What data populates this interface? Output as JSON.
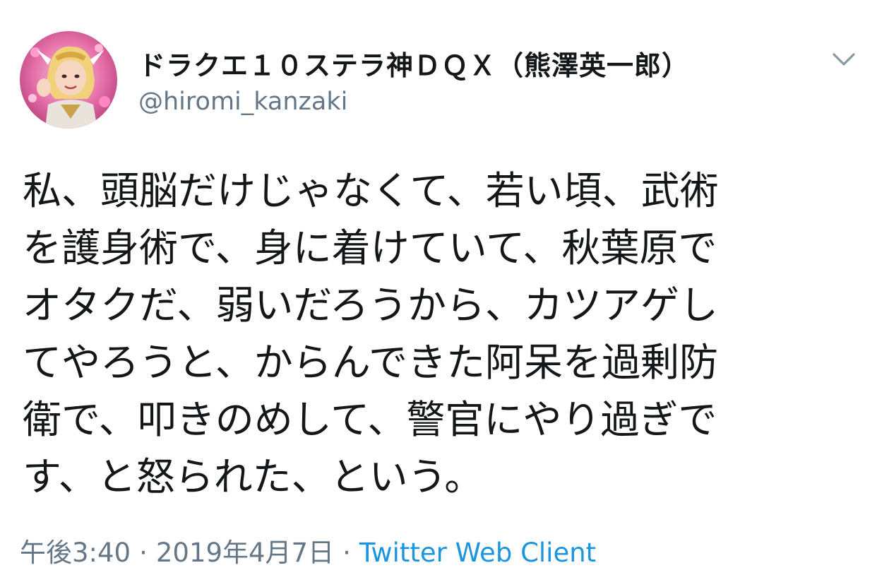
{
  "author": {
    "display_name": "ドラクエ１０ステラ神ＤＱＸ（熊澤英一郎）",
    "handle": "@hiromi_kanzaki",
    "avatar_icon": "avatar-illustration"
  },
  "menu": {
    "icon": "chevron-down-icon"
  },
  "tweet": {
    "lines": [
      "私、頭脳だけじゃなくて、若い頃、武術",
      "を護身術で、身に着けていて、秋葉原で",
      "オタクだ、弱いだろうから、カツアゲし",
      "てやろうと、からんできた阿呆を過剰防",
      "衛で、叩きのめして、警官にやり過ぎで",
      "す、と怒られた、という。"
    ]
  },
  "meta": {
    "time": "午後3:40",
    "separator": "·",
    "date": "2019年4月7日",
    "source": "Twitter Web Client"
  },
  "colors": {
    "text": "#14171a",
    "secondary": "#657786",
    "link": "#1b95e0"
  }
}
